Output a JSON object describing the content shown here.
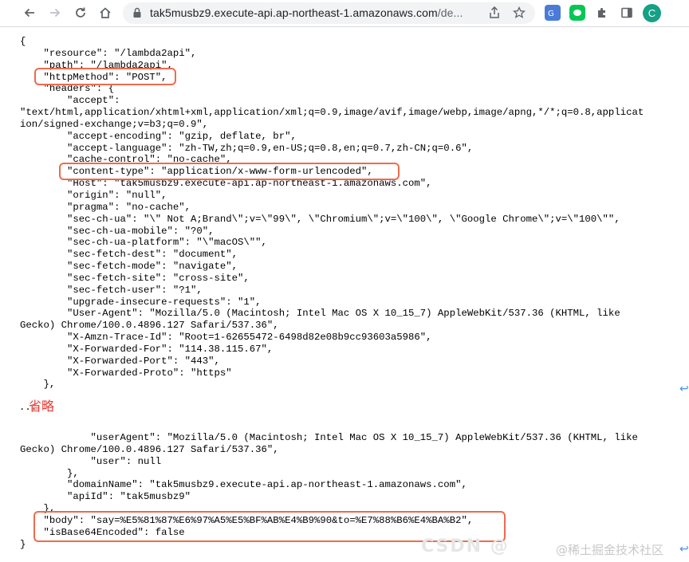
{
  "browser": {
    "url_domain": "tak5musbz9.execute-api.ap-northeast-1.amazonaws.com",
    "url_rest": "/de...",
    "profile_initial": "C"
  },
  "code_top": [
    "{",
    "    \"resource\": \"/lambda2api\",",
    "    \"path\": \"/lambda2api\",",
    "    \"httpMethod\": \"POST\",",
    "    \"headers\": {",
    "        \"accept\":",
    "\"text/html,application/xhtml+xml,application/xml;q=0.9,image/avif,image/webp,image/apng,*/*;q=0.8,applicat",
    "ion/signed-exchange;v=b3;q=0.9\",",
    "        \"accept-encoding\": \"gzip, deflate, br\",",
    "        \"accept-language\": \"zh-TW,zh;q=0.9,en-US;q=0.8,en;q=0.7,zh-CN;q=0.6\",",
    "        \"cache-control\": \"no-cache\",",
    "        \"content-type\": \"application/x-www-form-urlencoded\",",
    "        \"Host\": \"tak5musbz9.execute-api.ap-northeast-1.amazonaws.com\",",
    "        \"origin\": \"null\",",
    "        \"pragma\": \"no-cache\",",
    "        \"sec-ch-ua\": \"\\\" Not A;Brand\\\";v=\\\"99\\\", \\\"Chromium\\\";v=\\\"100\\\", \\\"Google Chrome\\\";v=\\\"100\\\"\",",
    "        \"sec-ch-ua-mobile\": \"?0\",",
    "        \"sec-ch-ua-platform\": \"\\\"macOS\\\"\",",
    "        \"sec-fetch-dest\": \"document\",",
    "        \"sec-fetch-mode\": \"navigate\",",
    "        \"sec-fetch-site\": \"cross-site\",",
    "        \"sec-fetch-user\": \"?1\",",
    "        \"upgrade-insecure-requests\": \"1\",",
    "        \"User-Agent\": \"Mozilla/5.0 (Macintosh; Intel Mac OS X 10_15_7) AppleWebKit/537.36 (KHTML, like",
    "Gecko) Chrome/100.0.4896.127 Safari/537.36\",",
    "        \"X-Amzn-Trace-Id\": \"Root=1-62655472-6498d82e08b9cc93603a5986\",",
    "        \"X-Forwarded-For\": \"114.38.115.67\",",
    "        \"X-Forwarded-Port\": \"443\",",
    "        \"X-Forwarded-Proto\": \"https\"",
    "    },"
  ],
  "omit_label": "省略",
  "dots": "...",
  "code_bottom": [
    "            \"userAgent\": \"Mozilla/5.0 (Macintosh; Intel Mac OS X 10_15_7) AppleWebKit/537.36 (KHTML, like",
    "Gecko) Chrome/100.0.4896.127 Safari/537.36\",",
    "            \"user\": null",
    "        },",
    "        \"domainName\": \"tak5musbz9.execute-api.ap-northeast-1.amazonaws.com\",",
    "        \"apiId\": \"tak5musbz9\"",
    "    },",
    "    \"body\": \"say=%E5%81%87%E6%97%A5%E5%BF%AB%E4%B9%90&to=%E7%88%B6%E4%BA%B2\",",
    "    \"isBase64Encoded\": false",
    "}"
  ],
  "watermark": "CSDN @",
  "watermark_site": "@稀土掘金技术社区",
  "colors": {
    "highlight": "#ee6b4d",
    "omit_text": "#e53935"
  }
}
